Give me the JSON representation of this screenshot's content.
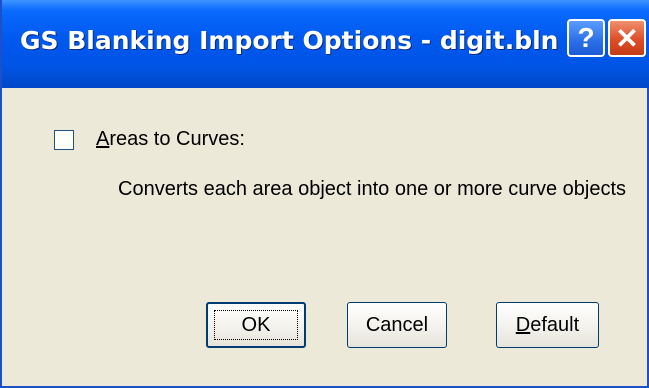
{
  "window": {
    "title": "GS Blanking Import Options - digit.bln",
    "help_glyph": "?",
    "close_glyph": "✕"
  },
  "options": {
    "areas_to_curves": {
      "label_accel": "A",
      "label_rest": "reas to Curves:",
      "checked": false,
      "description": "Converts each area object into one or more curve objects"
    }
  },
  "buttons": {
    "ok": "OK",
    "cancel": "Cancel",
    "default_accel": "D",
    "default_rest": "efault"
  },
  "colors": {
    "title_bar": "#0058ee",
    "dialog_bg": "#ece9d8",
    "close_button": "#dd4e27",
    "help_button": "#2a6fe8"
  }
}
